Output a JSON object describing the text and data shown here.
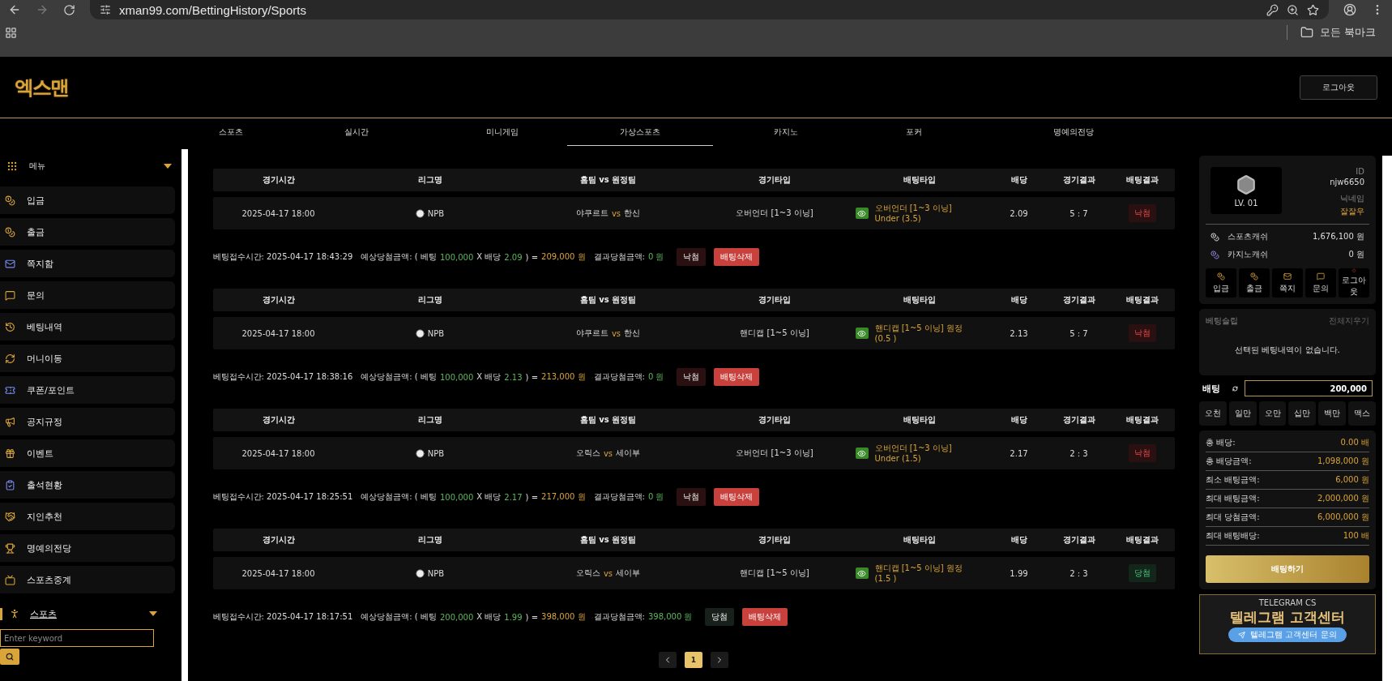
{
  "browser": {
    "url": "xman99.com/BettingHistory/Sports",
    "bookmarks_label": "모든 북마크"
  },
  "header": {
    "logo": "엑스맨",
    "logout": "로그아웃"
  },
  "nav": [
    {
      "label": "스포츠",
      "selected": false
    },
    {
      "label": "실시간",
      "selected": false
    },
    {
      "label": "미니게임",
      "selected": false
    },
    {
      "label": "가상스포츠",
      "selected": true
    },
    {
      "label": "카지노",
      "selected": false
    },
    {
      "label": "포커",
      "selected": false
    },
    {
      "label": "명예의전당",
      "selected": false
    }
  ],
  "sidebar": {
    "menu_title": "메뉴",
    "items": [
      {
        "label": "입금"
      },
      {
        "label": "출금"
      },
      {
        "label": "쪽지함"
      },
      {
        "label": "문의"
      },
      {
        "label": "베팅내역"
      },
      {
        "label": "머니이동"
      },
      {
        "label": "쿠폰/포인트"
      },
      {
        "label": "공지규정"
      },
      {
        "label": "이벤트"
      },
      {
        "label": "출석현황"
      },
      {
        "label": "지인추천"
      },
      {
        "label": "명예의전당"
      },
      {
        "label": "스포츠중계"
      }
    ],
    "sports_title": "스포츠",
    "search": {
      "placeholder": "Enter keyword"
    }
  },
  "bets": [
    {
      "columns": [
        "경기시간",
        "리그명",
        "홈팀 vs 원정팀",
        "경기타입",
        "배팅타입",
        "배당",
        "경기결과",
        "배팅결과"
      ],
      "row": {
        "time": "2025-04-17 18:00",
        "league": "NPB",
        "home": "야쿠르트",
        "vs": "vs",
        "away": "한신",
        "game_type": "오버언더 [1~3 이닝]",
        "bet_type": "오버언더 [1~3 이닝]",
        "bet_sub": "Under (3.5)",
        "odds": "2.09",
        "score": "5 : 7",
        "result": {
          "label": "낙첨",
          "won": false
        }
      },
      "summary": {
        "received": "베팅접수시간: 2025-04-17 18:43:29",
        "expected_label": "예상당첨금액: ( 베팅",
        "stake": "100,000",
        "odds_label": "X 배당",
        "odds": "2.09",
        "equals": ") =",
        "expected": "209,000 원",
        "result_label": "결과당첨금액:",
        "result_amount": "0 원"
      },
      "status": {
        "label": "낙첨",
        "won": false
      },
      "delete": "배팅삭제"
    },
    {
      "columns": [
        "경기시간",
        "리그명",
        "홈팀 vs 원정팀",
        "경기타입",
        "배팅타입",
        "배당",
        "경기결과",
        "배팅결과"
      ],
      "row": {
        "time": "2025-04-17 18:00",
        "league": "NPB",
        "home": "야쿠르트",
        "vs": "vs",
        "away": "한신",
        "game_type": "핸디캡 [1~5 이닝]",
        "bet_type": "핸디캡 [1~5 이닝] 원정",
        "bet_sub": "(0.5 )",
        "odds": "2.13",
        "score": "5 : 7",
        "result": {
          "label": "낙첨",
          "won": false
        }
      },
      "summary": {
        "received": "베팅접수시간: 2025-04-17 18:38:16",
        "expected_label": "예상당첨금액: ( 베팅",
        "stake": "100,000",
        "odds_label": "X 배당",
        "odds": "2.13",
        "equals": ") =",
        "expected": "213,000 원",
        "result_label": "결과당첨금액:",
        "result_amount": "0 원"
      },
      "status": {
        "label": "낙첨",
        "won": false
      },
      "delete": "배팅삭제"
    },
    {
      "columns": [
        "경기시간",
        "리그명",
        "홈팀 vs 원정팀",
        "경기타입",
        "배팅타입",
        "배당",
        "경기결과",
        "배팅결과"
      ],
      "row": {
        "time": "2025-04-17 18:00",
        "league": "NPB",
        "home": "오릭스",
        "vs": "vs",
        "away": "세이부",
        "game_type": "오버언더 [1~3 이닝]",
        "bet_type": "오버언더 [1~3 이닝]",
        "bet_sub": "Under (1.5)",
        "odds": "2.17",
        "score": "2 : 3",
        "result": {
          "label": "낙첨",
          "won": false
        }
      },
      "summary": {
        "received": "베팅접수시간: 2025-04-17 18:25:51",
        "expected_label": "예상당첨금액: ( 베팅",
        "stake": "100,000",
        "odds_label": "X 배당",
        "odds": "2.17",
        "equals": ") =",
        "expected": "217,000 원",
        "result_label": "결과당첨금액:",
        "result_amount": "0 원"
      },
      "status": {
        "label": "낙첨",
        "won": false
      },
      "delete": "배팅삭제"
    },
    {
      "columns": [
        "경기시간",
        "리그명",
        "홈팀 vs 원정팀",
        "경기타입",
        "배팅타입",
        "배당",
        "경기결과",
        "배팅결과"
      ],
      "row": {
        "time": "2025-04-17 18:00",
        "league": "NPB",
        "home": "오릭스",
        "vs": "vs",
        "away": "세이부",
        "game_type": "핸디캡 [1~5 이닝]",
        "bet_type": "핸디캡 [1~5 이닝] 원정",
        "bet_sub": "(1.5 )",
        "odds": "1.99",
        "score": "2 : 3",
        "result": {
          "label": "당첨",
          "won": true
        }
      },
      "summary": {
        "received": "베팅접수시간: 2025-04-17 18:17:51",
        "expected_label": "예상당첨금액: ( 베팅",
        "stake": "200,000",
        "odds_label": "X 배당",
        "odds": "1.99",
        "equals": ") =",
        "expected": "398,000 원",
        "result_label": "결과당첨금액:",
        "result_amount": "398,000 원"
      },
      "status": {
        "label": "당첨",
        "won": true
      },
      "delete": "배팅삭제"
    }
  ],
  "pagination": {
    "pages": [
      {
        "label": "1",
        "selected": true
      }
    ]
  },
  "profile": {
    "level": "LV. 01",
    "id_label": "ID",
    "id": "njw6650",
    "nick_label": "닉네임",
    "nick": "잘잘우",
    "cash": [
      {
        "label": "스포츠캐쉬",
        "value": "1,676,100 원"
      },
      {
        "label": "카지노캐쉬",
        "value": "0 원"
      }
    ],
    "quick": [
      {
        "label": "입금"
      },
      {
        "label": "출금"
      },
      {
        "label": "쪽지"
      },
      {
        "label": "문의"
      },
      {
        "label": "로그아웃"
      }
    ]
  },
  "slip": {
    "title": "베팅슬립",
    "clear": "전체지우기",
    "empty": "선택된 베팅내역이 없습니다."
  },
  "bet": {
    "label": "배팅",
    "value": "200,000",
    "amounts": [
      "오천",
      "일만",
      "오만",
      "십만",
      "백만",
      "맥스"
    ]
  },
  "info": [
    {
      "label": "총 배당:",
      "value": "0.00 배"
    },
    {
      "label": "총 배당금액:",
      "value": "1,098,000 원"
    },
    {
      "label": "최소 배팅금액:",
      "value": "6,000 원"
    },
    {
      "label": "최대 배팅금액:",
      "value": "2,000,000 원"
    },
    {
      "label": "최대 당첨금액:",
      "value": "6,000,000 원"
    },
    {
      "label": "최대 배팅배당:",
      "value": "100 배"
    }
  ],
  "submit": "배팅하기",
  "banner": {
    "caption": "TELEGRAM CS",
    "title": "텔레그램 고객센터",
    "button": "텔레그램 고객센터 문의"
  }
}
